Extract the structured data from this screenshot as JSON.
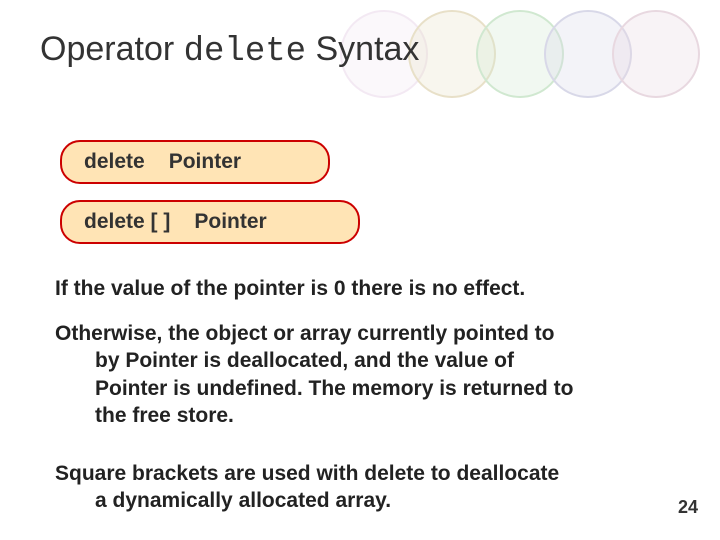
{
  "title": {
    "part1": "Operator ",
    "mono": "delete",
    "part2": " Syntax"
  },
  "syntax": {
    "box1_left": "delete",
    "box1_right": "Pointer",
    "box2_left": "delete  [ ]",
    "box2_right": "Pointer"
  },
  "paragraphs": {
    "p1": "If the value of the pointer is 0 there is no effect.",
    "p2_line1": "Otherwise, the object or array currently pointed to",
    "p2_line2": "by Pointer is deallocated, and the  value of",
    "p2_line3": "Pointer is undefined.  The memory is returned to",
    "p2_line4": "the free store.",
    "p3_line1": "Square brackets are used with delete to deallocate",
    "p3_line2": "a dynamically allocated array."
  },
  "page_number": "24"
}
